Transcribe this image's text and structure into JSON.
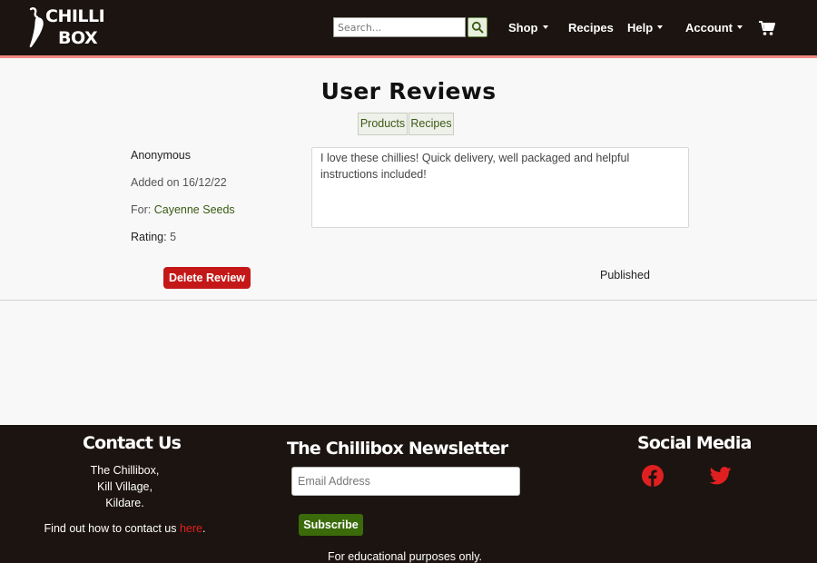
{
  "brand": {
    "line1": "CHILLI",
    "line2": "BOX"
  },
  "search": {
    "placeholder": "Search..."
  },
  "nav": {
    "shop": "Shop",
    "recipes": "Recipes",
    "help": "Help",
    "account": "Account"
  },
  "page": {
    "title": "User Reviews",
    "tabs": [
      "Products",
      "Recipes"
    ]
  },
  "review": {
    "author": "Anonymous",
    "added_label": "Added on",
    "added_date": "16/12/22",
    "for_label": "For:",
    "product": "Cayenne Seeds",
    "rating_label": "Rating:",
    "rating_value": "5",
    "text": "I love these chillies! Quick delivery, well packaged and helpful instructions included!",
    "delete_label": "Delete Review",
    "status": "Published"
  },
  "footer": {
    "contact": {
      "heading": "Contact Us",
      "address": [
        "The Chillibox,",
        "Kill Village,",
        "Kildare."
      ],
      "find_text": "Find out how to contact us ",
      "link_text": "here",
      "after_link": "."
    },
    "newsletter": {
      "heading": "The Chillibox Newsletter",
      "email_placeholder": "Email Address",
      "subscribe_label": "Subscribe",
      "note": "For educational purposes only."
    },
    "social": {
      "heading": "Social Media",
      "icons": [
        "facebook-icon",
        "twitter-icon"
      ]
    }
  },
  "colors": {
    "nav_bg": "#1c1410",
    "accent_red": "#c41818",
    "accent_green": "#3a6a0a",
    "link_green": "#3a5a12",
    "social_red": "#e02020"
  }
}
